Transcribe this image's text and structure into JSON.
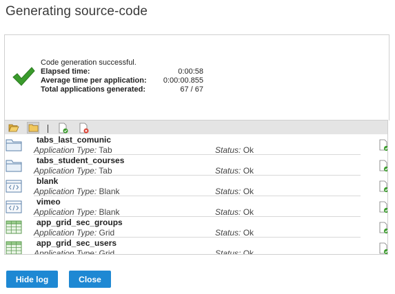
{
  "dialog": {
    "title": "Generating source-code"
  },
  "summary": {
    "message": "Code generation successful.",
    "stats": [
      {
        "label": "Elapsed time:",
        "value": "0:00:58"
      },
      {
        "label": "Average time per application:",
        "value": "0:00:00.855"
      },
      {
        "label": "Total applications generated:",
        "value": "67 / 67"
      }
    ]
  },
  "log": {
    "type_label": "Application Type:",
    "status_label": "Status:",
    "items": [
      {
        "name": "tabs_last_comunic",
        "type": "Tab",
        "status": "Ok",
        "icon": "folder-tab-icon"
      },
      {
        "name": "tabs_student_courses",
        "type": "Tab",
        "status": "Ok",
        "icon": "folder-tab-icon"
      },
      {
        "name": "blank",
        "type": "Blank",
        "status": "Ok",
        "icon": "code-window-icon"
      },
      {
        "name": "vimeo",
        "type": "Blank",
        "status": "Ok",
        "icon": "code-window-icon"
      },
      {
        "name": "app_grid_sec_groups",
        "type": "Grid",
        "status": "Ok",
        "icon": "grid-table-icon"
      },
      {
        "name": "app_grid_sec_users",
        "type": "Grid",
        "status": "Ok",
        "icon": "grid-table-icon"
      }
    ]
  },
  "buttons": {
    "hide_log": "Hide log",
    "close": "Close"
  },
  "colors": {
    "button_bg": "#1e88d3",
    "success_green": "#3a9b2c",
    "error_red": "#d93a2b"
  }
}
